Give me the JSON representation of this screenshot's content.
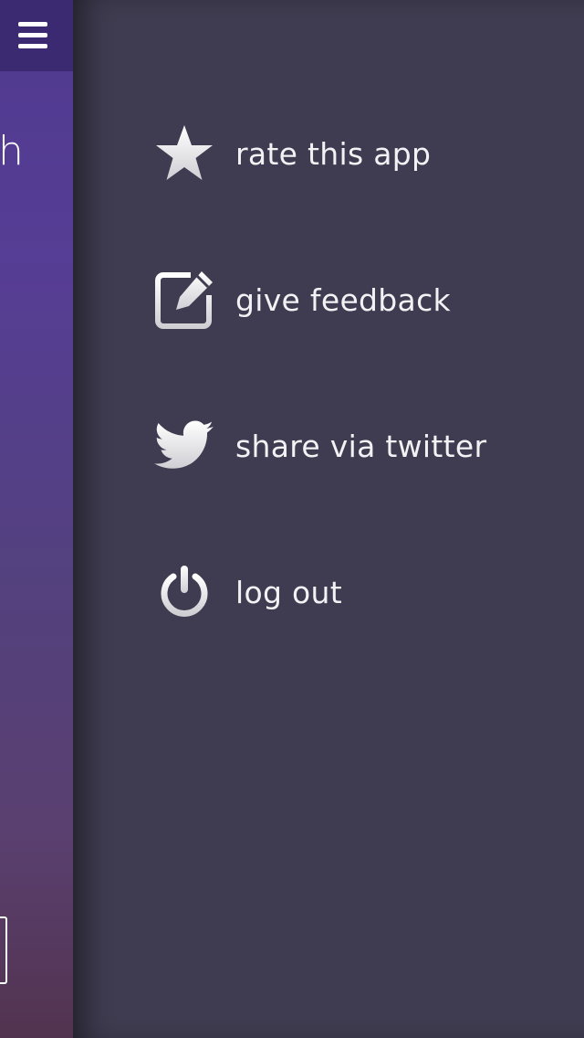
{
  "main_view": {
    "heading_fragment": "h"
  },
  "menu": {
    "items": [
      {
        "id": "rate",
        "label": "rate this app",
        "icon": "star-icon"
      },
      {
        "id": "feedback",
        "label": "give feedback",
        "icon": "edit-icon"
      },
      {
        "id": "twitter",
        "label": "share via twitter",
        "icon": "twitter-bird-icon"
      },
      {
        "id": "logout",
        "label": "log out",
        "icon": "power-icon"
      }
    ]
  },
  "colors": {
    "menu_background": "#3f3b50",
    "main_top": "#4f3a8f",
    "topbar": "#3b2a72",
    "text": "#f2f2f5",
    "icon": "#e8e8ea"
  }
}
